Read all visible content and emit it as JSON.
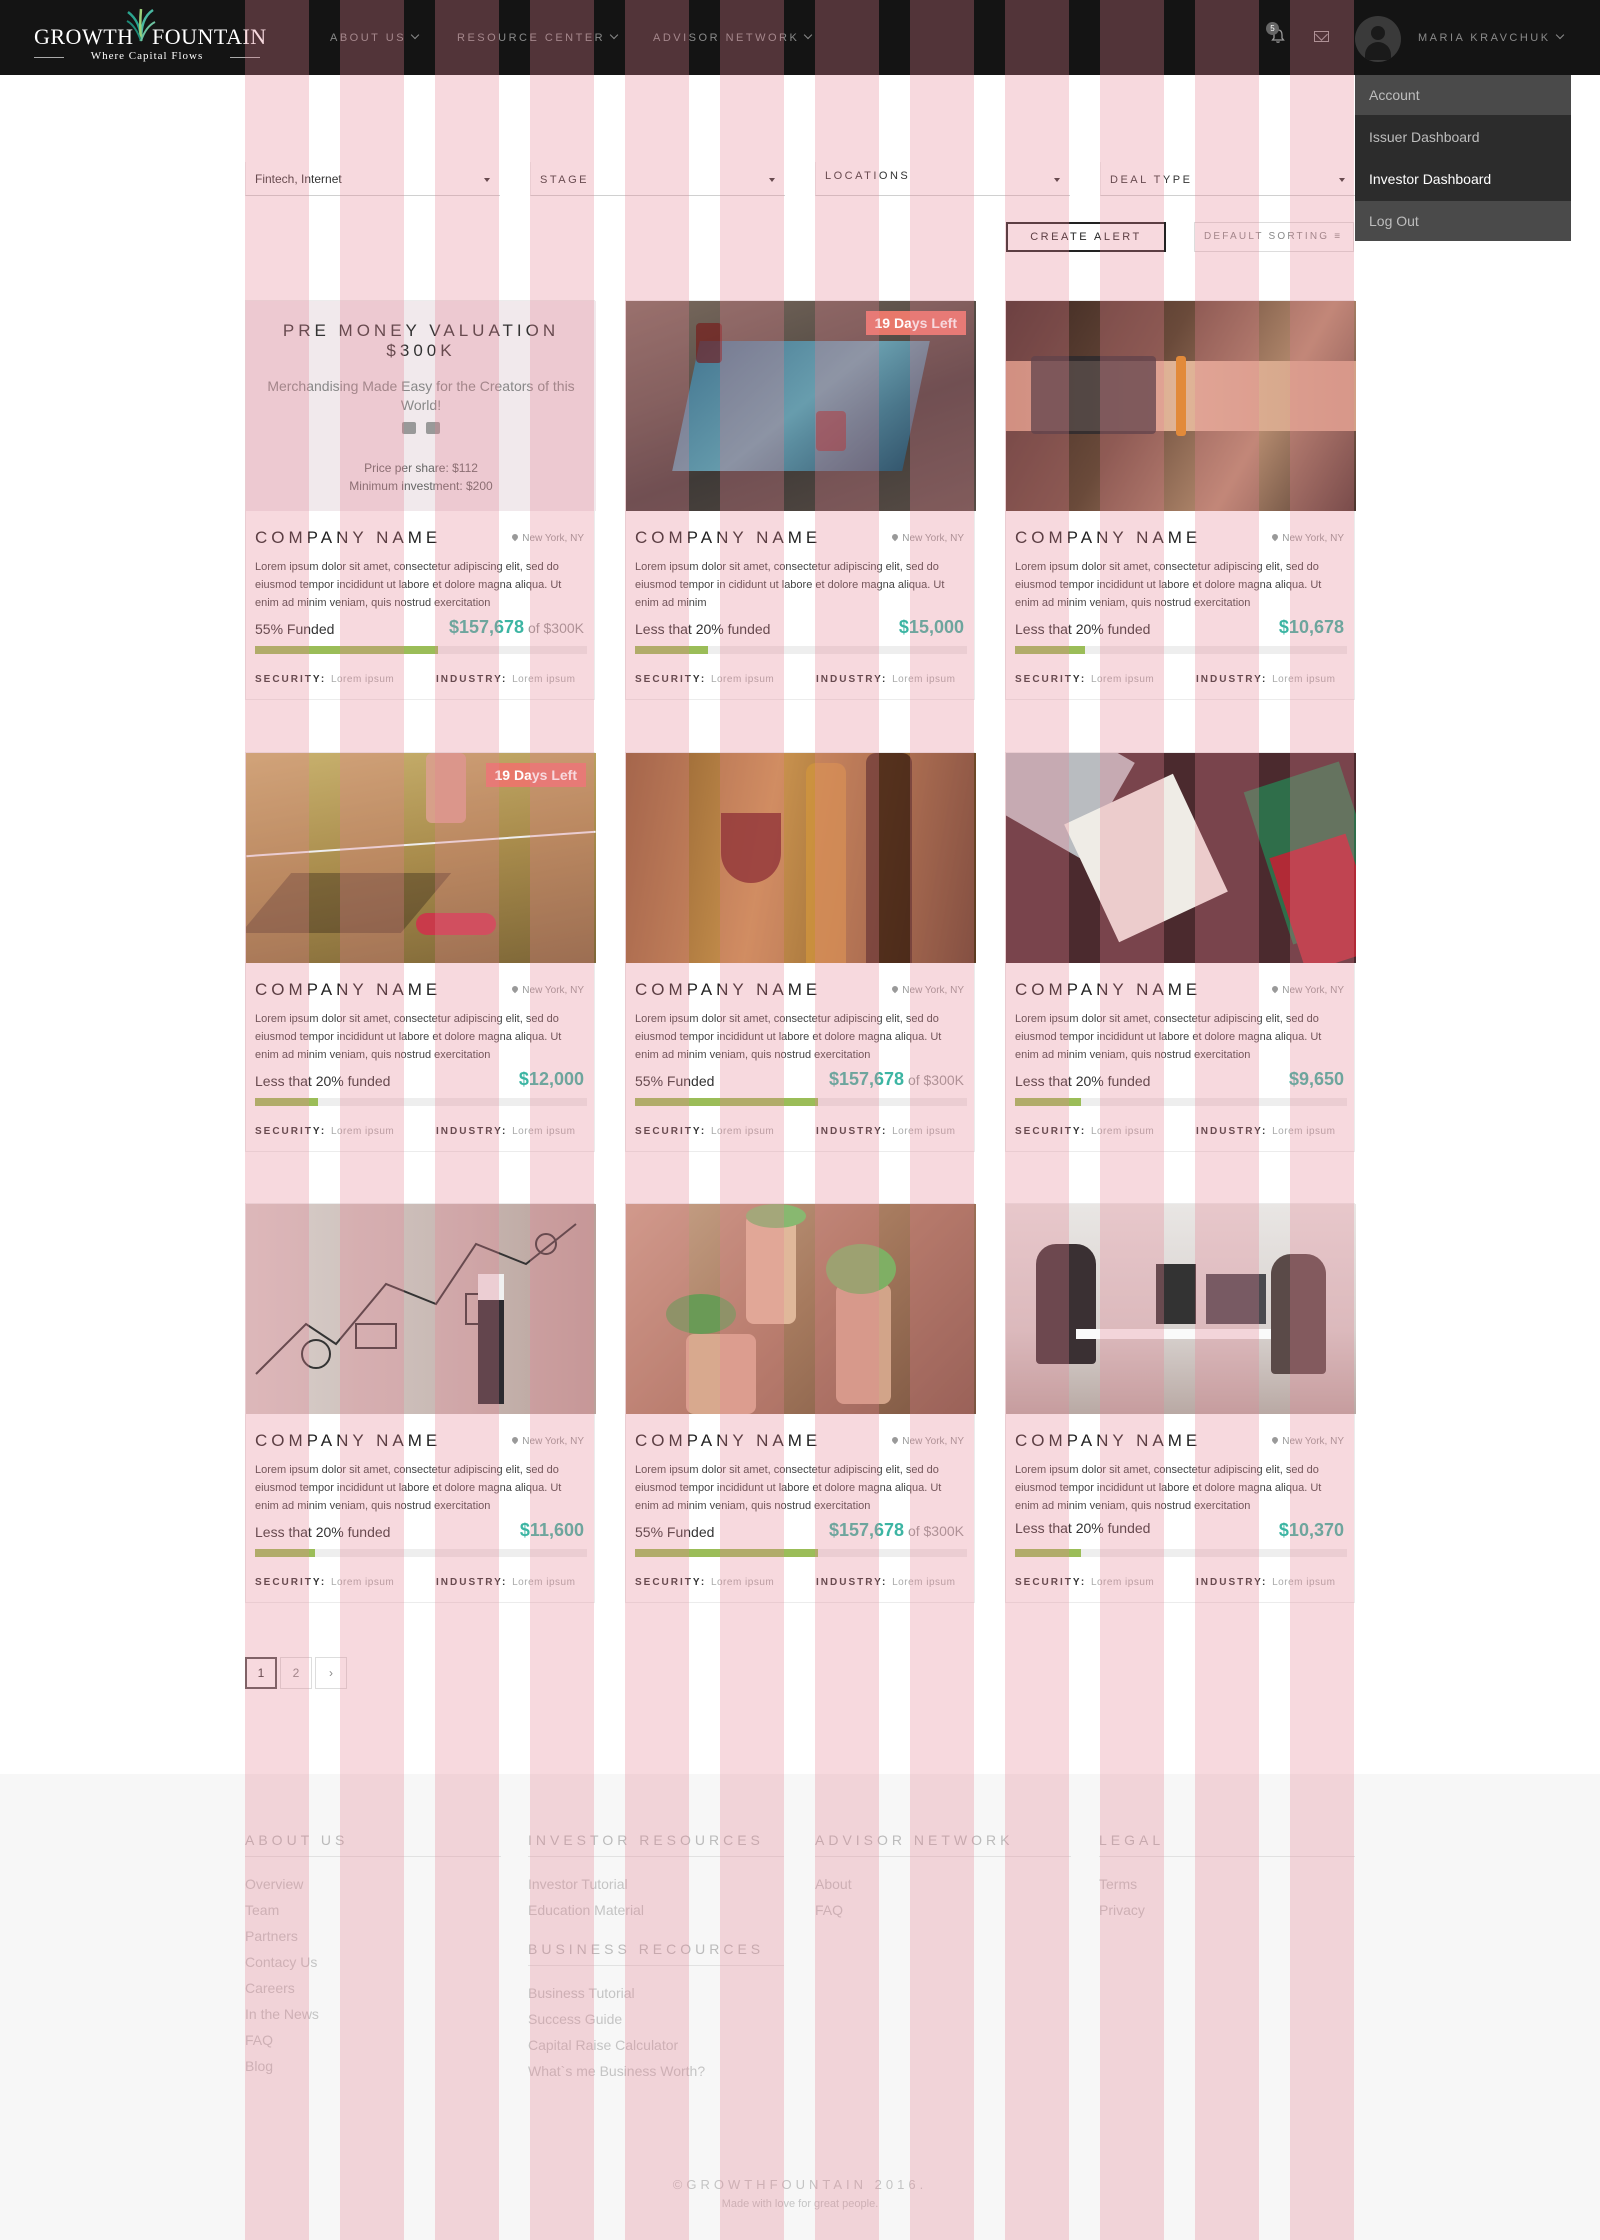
{
  "header": {
    "logo": {
      "word_left": "GROWTH",
      "word_right": "FOUNTAIN",
      "tagline": "Where Capital Flows"
    },
    "nav": [
      {
        "label": "ABOUT US"
      },
      {
        "label": "RESOURCE CENTER"
      },
      {
        "label": "ADVISOR NETWORK"
      }
    ],
    "notification_count": "5",
    "user_name": "MARIA KRAVCHUK",
    "icons": {
      "bell": "bell-icon",
      "mail": "mail-icon",
      "avatar": "user-avatar-icon",
      "caret": "chevron-down-icon"
    }
  },
  "user_menu": {
    "items": [
      {
        "label": "Account"
      },
      {
        "label": "Issuer Dashboard"
      },
      {
        "label": "Investor Dashboard"
      },
      {
        "label": "Log Out"
      }
    ],
    "active_index": 2
  },
  "filters": {
    "industry": {
      "value": "Fintech, Internet"
    },
    "stage": {
      "placeholder": "STAGE"
    },
    "locations": {
      "placeholder": "LOCATIONS"
    },
    "deal_type": {
      "placeholder": "DEAL TYPE"
    }
  },
  "actions": {
    "create_alert": "CREATE ALERT",
    "sorting": "DEFAULT SORTING ≡"
  },
  "cards": [
    {
      "valuation": {
        "title": "PRE MONEY VALUATION $300K",
        "tagline": "Merchandising Made Easy for the Creators of this World!",
        "price": "Price per share: $112",
        "minimum": "Minimum investment: $200"
      },
      "company": "COMPANY NAME",
      "location": "New York, NY",
      "description": "Lorem ipsum dolor sit amet, consectetur adipiscing elit, sed do eiusmod tempor incididunt ut labore et dolore magna aliqua. Ut enim ad minim veniam, quis nostrud exercitation",
      "funded_label": "55% Funded",
      "amount": "$157,678",
      "of_total": " of $300K",
      "progress": 0.55,
      "security_label": "SECURITY:",
      "security": "Lorem ipsum",
      "industry_label": "INDUSTRY:",
      "industry": "Lorem ipsum",
      "image": "valuation-overlay"
    },
    {
      "badge": "19 Days Left",
      "company": "COMPANY NAME",
      "location": "New York, NY",
      "description": "Lorem ipsum dolor sit amet, consectetur adipiscing elit, sed do eiusmod tempor in cididunt ut labore et dolore magna aliqua. Ut enim ad minim",
      "funded_label": "Less that 20% funded",
      "amount": "$15,000",
      "progress": 0.22,
      "security_label": "SECURITY:",
      "security": "Lorem ipsum",
      "industry_label": "INDUSTRY:",
      "industry": "Lorem ipsum",
      "image": "touch-table-photo"
    },
    {
      "company": "COMPANY NAME",
      "location": "New York, NY",
      "description": "Lorem ipsum dolor sit amet, consectetur adipiscing elit, sed do eiusmod tempor incididunt ut labore et dolore magna aliqua. Ut enim ad minim veniam, quis nostrud exercitation",
      "funded_label": "Less that 20%  funded",
      "amount": "$10,678",
      "progress": 0.21,
      "security_label": "SECURITY:",
      "security": "Lorem ipsum",
      "industry_label": "INDUSTRY:",
      "industry": "Lorem ipsum",
      "image": "wrist-projection-photo"
    },
    {
      "badge": "19 Days Left",
      "company": "COMPANY NAME",
      "location": "New York, NY",
      "description": "Lorem ipsum dolor sit amet, consectetur adipiscing elit, sed do eiusmod tempor incididunt ut labore et dolore magna aliqua. Ut enim ad minim veniam, quis nostrud exercitation",
      "funded_label": "Less that 20% funded",
      "amount": "$12,000",
      "progress": 0.19,
      "security_label": "SECURITY:",
      "security": "Lorem ipsum",
      "industry_label": "INDUSTRY:",
      "industry": "Lorem ipsum",
      "image": "hoverboard-photo"
    },
    {
      "company": "COMPANY NAME",
      "location": "New York, NY",
      "description": "Lorem ipsum dolor sit amet, consectetur adipiscing elit, sed do eiusmod tempor incididunt ut labore et dolore magna aliqua. Ut enim ad minim veniam, quis nostrud exercitation",
      "funded_label": "55% Funded",
      "amount": "$157,678",
      "of_total": " of $300K",
      "progress": 0.55,
      "security_label": "SECURITY:",
      "security": "Lorem ipsum",
      "industry_label": "INDUSTRY:",
      "industry": "Lorem ipsum",
      "image": "wine-bottles-photo"
    },
    {
      "company": "COMPANY NAME",
      "location": "New York, NY",
      "description": "Lorem ipsum dolor sit amet, consectetur adipiscing elit, sed do eiusmod tempor incididunt ut labore et dolore magna aliqua. Ut enim ad minim veniam, quis nostrud exercitation",
      "funded_label": "Less that 20% funded",
      "amount": "$9,650",
      "progress": 0.2,
      "security_label": "SECURITY:",
      "security": "Lorem ipsum",
      "industry_label": "INDUSTRY:",
      "industry": "Lorem ipsum",
      "image": "desk-notebook-photo"
    },
    {
      "company": "COMPANY NAME",
      "location": "New York, NY",
      "description": "Lorem ipsum dolor sit amet, consectetur adipiscing elit, sed do eiusmod tempor incididunt ut labore et dolore magna aliqua. Ut enim ad minim veniam, quis nostrud exercitation",
      "funded_label": "Less that 20% funded",
      "amount": "$11,600",
      "progress": 0.18,
      "security_label": "SECURITY:",
      "security": "Lorem ipsum",
      "industry_label": "INDUSTRY:",
      "industry": "Lorem ipsum",
      "image": "sketch-wall-photo"
    },
    {
      "company": "COMPANY NAME",
      "location": "New York, NY",
      "description": "Lorem ipsum dolor sit amet, consectetur adipiscing elit, sed do eiusmod tempor incididunt ut labore et dolore magna aliqua. Ut enim ad minim veniam, quis nostrud exercitation",
      "funded_label": "55% Funded",
      "amount": "$157,678",
      "of_total": " of $300K",
      "progress": 0.55,
      "security_label": "SECURITY:",
      "security": "Lorem ipsum",
      "industry_label": "INDUSTRY:",
      "industry": "Lorem ipsum",
      "image": "succulent-corks-photo"
    },
    {
      "company": "COMPANY NAME",
      "location": "New York, NY",
      "description": "Lorem ipsum dolor sit amet, consectetur adipiscing elit, sed do eiusmod tempor incididunt ut labore et dolore magna aliqua. Ut enim ad minim veniam, quis nostrud exercitation",
      "funded_label": "Less that 20% funded",
      "amount": "$10,370",
      "progress": 0.2,
      "security_label": "SECURITY:",
      "security": "Lorem ipsum",
      "industry_label": "INDUSTRY:",
      "industry": "Lorem ipsum",
      "image": "office-workers-photo"
    }
  ],
  "pagination": {
    "pages": [
      "1",
      "2"
    ],
    "current": "1",
    "next": "›"
  },
  "footer": {
    "about": {
      "heading": "ABOUT US",
      "links": [
        "Overview",
        "Team",
        "Partners",
        "Contacy Us",
        "Careers",
        "In the News",
        "FAQ",
        "Blog"
      ]
    },
    "investor": {
      "heading": "INVESTOR RESOURCES",
      "links": [
        "Investor Tutorial",
        "Education Material"
      ]
    },
    "business": {
      "heading": "BUSINESS RECOURCES",
      "links": [
        "Business Tutorial",
        "Success Guide",
        "Capital Raise Calculator",
        "What`s me Business Worth?"
      ]
    },
    "advisor": {
      "heading": "ADVISOR NETWORK",
      "links": [
        "About",
        "FAQ"
      ]
    },
    "legal": {
      "heading": "LEGAL",
      "links": [
        "Terms",
        "Privacy"
      ]
    },
    "copyright": "©GROWTHFOUNTAIN 2016.",
    "made_with": "Made with love for great people."
  },
  "colors": {
    "accent_teal": "#3cb5a3",
    "progress_green": "#9bbd58",
    "badge_coral": "#e8786a",
    "header_bg": "#141414",
    "grid_overlay": "#e68291"
  }
}
